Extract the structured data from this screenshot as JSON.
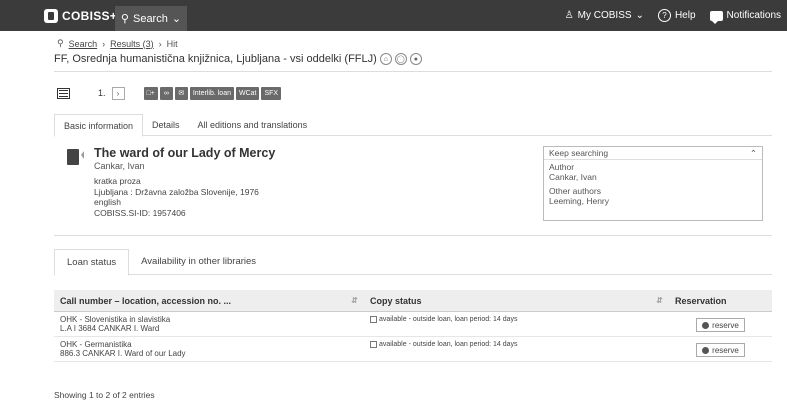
{
  "topbar": {
    "logo_text": "COBISS+",
    "search_label": "Search",
    "my_cobiss": "My COBISS",
    "help": "Help",
    "notifications": "Notifications"
  },
  "breadcrumb": {
    "search": "Search",
    "results": "Results (3)",
    "hit": "Hit"
  },
  "library_title": "FF, Osrednja humanistična knjižnica, Ljubljana - vsi oddelki (FFLJ)",
  "toolbar": {
    "hit_number": "1.",
    "interlib": "Interlib. loan",
    "wcat": "WCat",
    "sfx": "SFX"
  },
  "tabs": [
    "Basic information",
    "Details",
    "All editions and translations"
  ],
  "record": {
    "title": "The ward of our Lady of Mercy",
    "author": "Cankar, Ivan",
    "meta": [
      "kratka proza",
      "Ljubljana : Državna založba Slovenije, 1976",
      "english",
      "COBISS.SI-ID: 1957406"
    ]
  },
  "keep_searching": {
    "header": "Keep searching",
    "author_label": "Author",
    "author": "Cankar, Ivan",
    "other_label": "Other authors",
    "other": "Leeming, Henry"
  },
  "loan_tabs": [
    "Loan status",
    "Availability in other libraries"
  ],
  "table": {
    "headers": [
      "Call number – location, accession no. ...",
      "Copy status",
      "Reservation"
    ],
    "rows": [
      {
        "location": "OHK - Slovenistika in slavistika",
        "accession": "L.A I 3684 CANKAR I. Ward",
        "status": "available - outside loan, loan period: 14 days",
        "action": "reserve"
      },
      {
        "location": "OHK - Germanistika",
        "accession": "886.3 CANKAR I. Ward of our Lady",
        "status": "available - outside loan, loan period: 14 days",
        "action": "reserve"
      }
    ]
  },
  "showing": "Showing 1 to 2 of 2 entries"
}
